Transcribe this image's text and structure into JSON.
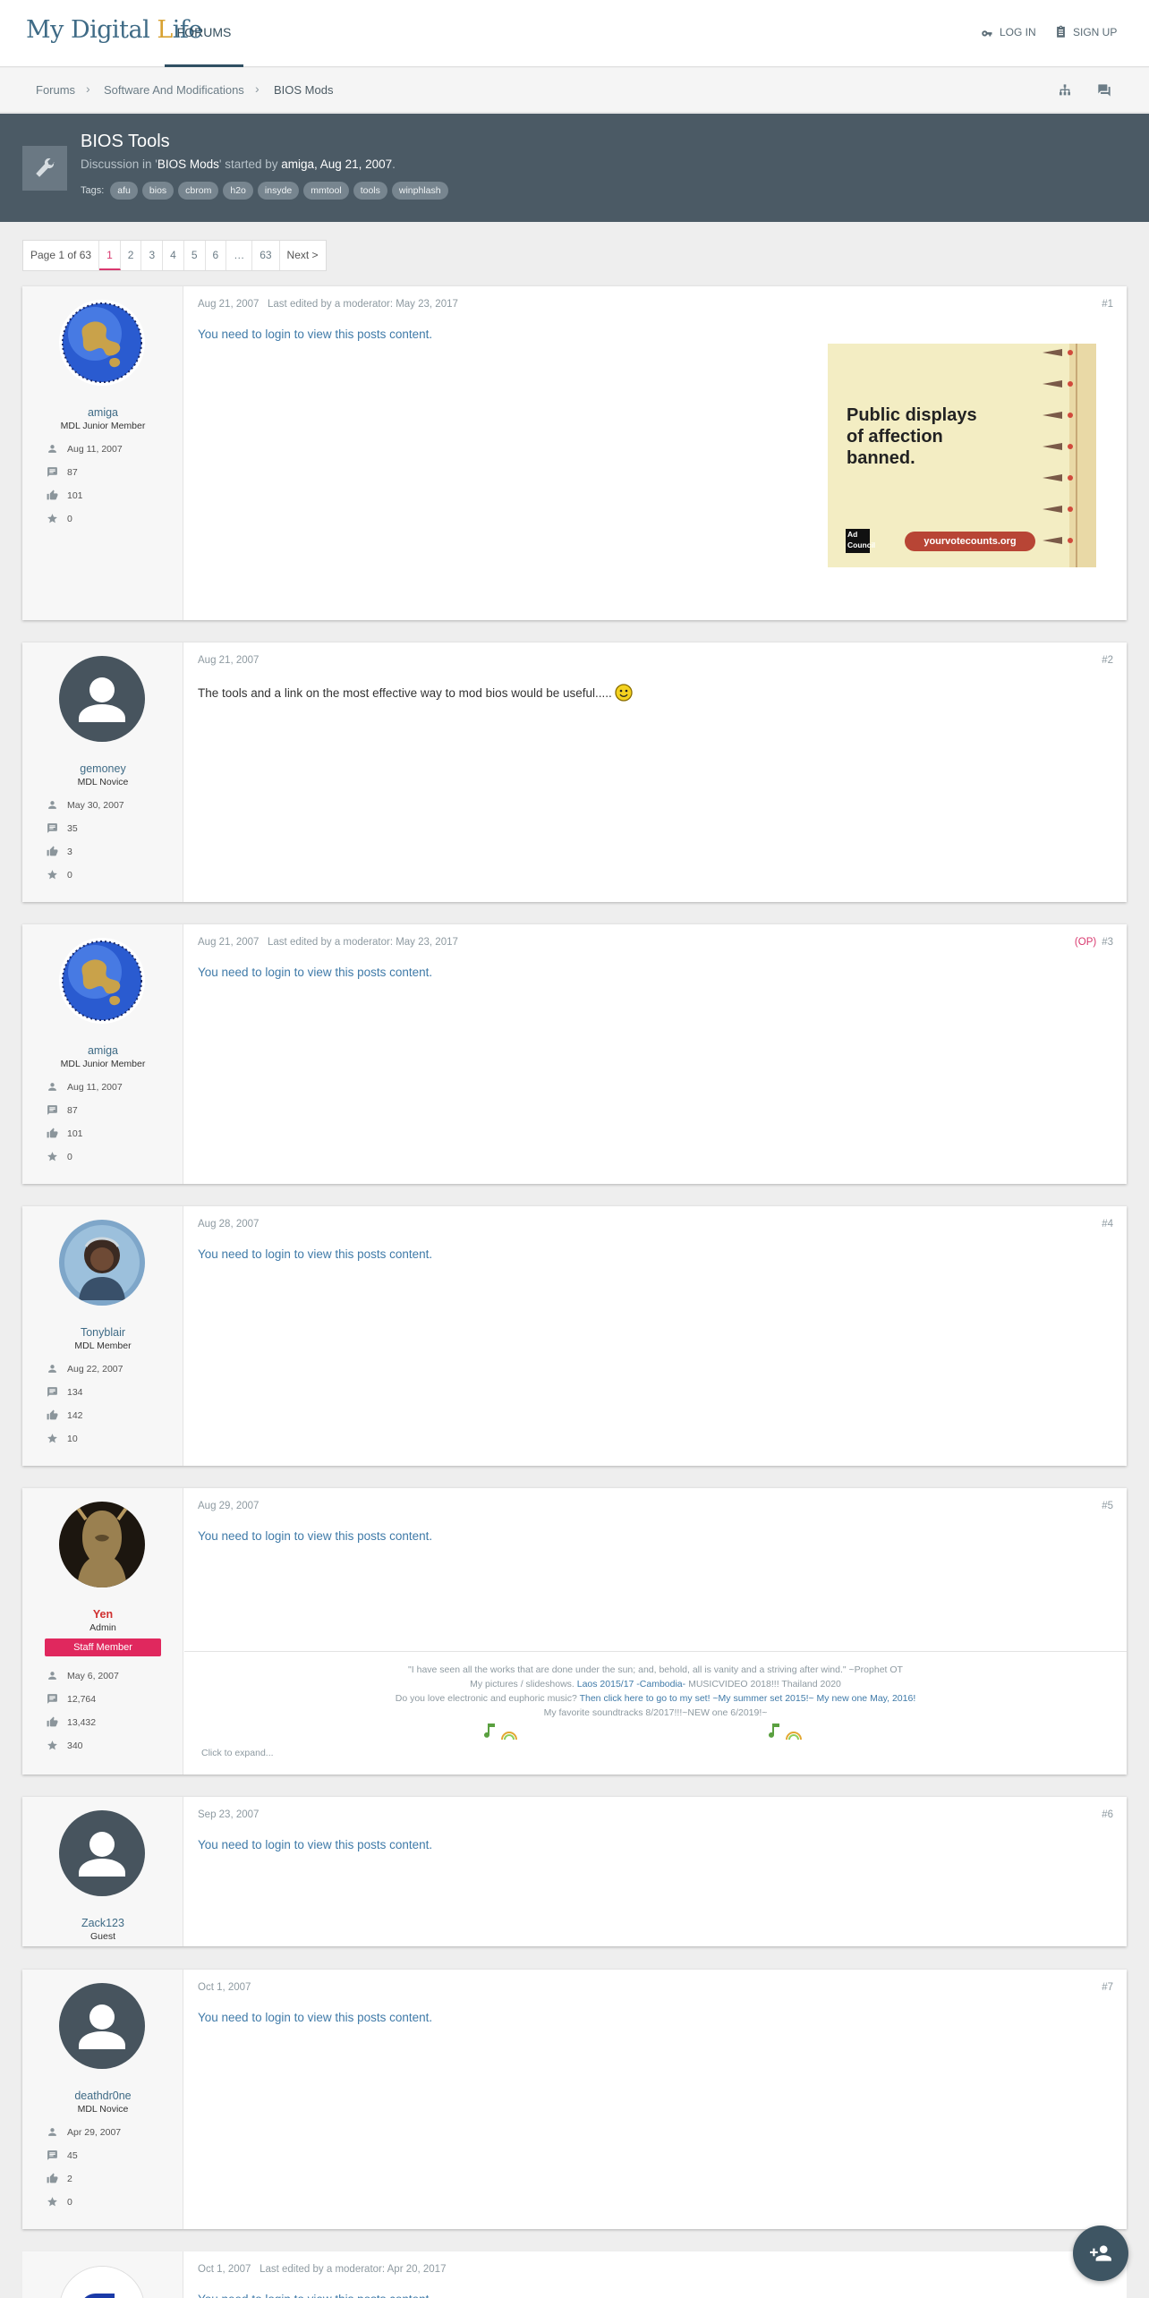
{
  "header": {
    "logo_main": "My Digital ",
    "logo_cap": "L",
    "logo_rest": "ife",
    "nav_forums": "FORUMS",
    "login": "LOG IN",
    "signup": "SIGN UP"
  },
  "breadcrumbs": [
    "Forums",
    "Software And Modifications",
    "BIOS Mods"
  ],
  "thread": {
    "title": "BIOS Tools",
    "meta_prefix": "Discussion in '",
    "forum": "BIOS Mods",
    "meta_mid": "' started by ",
    "author": "amiga",
    "meta_comma": ", ",
    "date": "Aug 21, 2007",
    "meta_end": ".",
    "tags_label": "Tags:",
    "tags": [
      "afu",
      "bios",
      "cbrom",
      "h2o",
      "insyde",
      "mmtool",
      "tools",
      "winphlash"
    ]
  },
  "pagination": {
    "label": "Page 1 of 63",
    "pages": [
      "1",
      "2",
      "3",
      "4",
      "5",
      "6",
      "…",
      "63"
    ],
    "next": "Next >"
  },
  "login_prompt": "You need to login to view this posts content.",
  "ad": {
    "line1": "Public displays",
    "line2": "of affection",
    "line3": "banned.",
    "url": "yourvotecounts.org",
    "badge": "Ad Council"
  },
  "posts": [
    {
      "user": "amiga",
      "title": "MDL Junior Member",
      "joined": "Aug 11, 2007",
      "messages": "87",
      "likes": "101",
      "points": "0",
      "date": "Aug 21, 2007",
      "edit": "Last edited by a moderator: May 23, 2017",
      "num": "#1"
    },
    {
      "user": "gemoney",
      "title": "MDL Novice",
      "joined": "May 30, 2007",
      "messages": "35",
      "likes": "3",
      "points": "0",
      "date": "Aug 21, 2007",
      "edit": "",
      "num": "#2",
      "body": "The tools and a link on the most effective way to mod bios would be useful....."
    },
    {
      "user": "amiga",
      "title": "MDL Junior Member",
      "joined": "Aug 11, 2007",
      "messages": "87",
      "likes": "101",
      "points": "0",
      "date": "Aug 21, 2007",
      "edit": "Last edited by a moderator: May 23, 2017",
      "num": "#3",
      "op": "(OP)"
    },
    {
      "user": "Tonyblair",
      "title": "MDL Member",
      "joined": "Aug 22, 2007",
      "messages": "134",
      "likes": "142",
      "points": "10",
      "date": "Aug 28, 2007",
      "edit": "",
      "num": "#4"
    },
    {
      "user": "Yen",
      "title": "Admin",
      "badge": "Staff Member",
      "joined": "May 6, 2007",
      "messages": "12,764",
      "likes": "13,432",
      "points": "340",
      "date": "Aug 29, 2007",
      "edit": "",
      "num": "#5"
    },
    {
      "user": "Zack123",
      "title": "Guest",
      "date": "Sep 23, 2007",
      "edit": "",
      "num": "#6"
    },
    {
      "user": "deathdr0ne",
      "title": "MDL Novice",
      "joined": "Apr 29, 2007",
      "messages": "45",
      "likes": "2",
      "points": "0",
      "date": "Oct 1, 2007",
      "edit": "",
      "num": "#7"
    },
    {
      "date": "Oct 1, 2007",
      "edit": "Last edited by a moderator: Apr 20, 2017"
    }
  ],
  "signature": {
    "line1": "\"I have seen all the works that are done under the sun; and, behold, all is vanity and a striving after wind.\" ~Prophet OT",
    "line2_pre": "My pictures / slideshows. ",
    "line2_link": "Laos 2015/17 -Cambodia-",
    "line2_post": " MUSICVIDEO 2018!!! Thailand 2020",
    "line3_pre": "Do you love electronic and euphoric music? ",
    "line3_link": "Then click here to go to my set! ~My summer set 2015!~ My new one May, 2016!",
    "line4": "My favorite soundtracks 8/2017!!!~NEW one 6/2019!~",
    "expand": "Click to expand..."
  }
}
